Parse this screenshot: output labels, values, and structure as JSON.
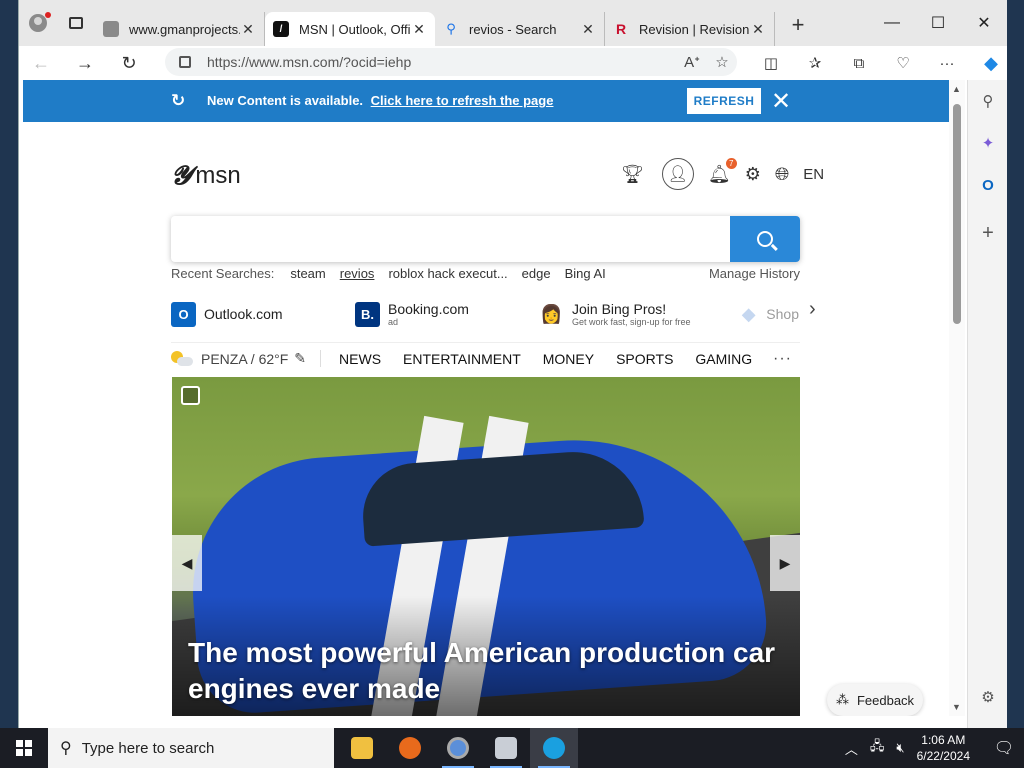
{
  "browser": {
    "tabs": [
      {
        "title": "www.gmanprojects.",
        "favicon_color": "#777777",
        "active": false
      },
      {
        "title": "MSN | Outlook, Offi",
        "favicon_color": "#111111",
        "active": true
      },
      {
        "title": "revios - Search",
        "favicon_color": "#1a73e8",
        "active": false
      },
      {
        "title": "Revision | Revision",
        "favicon_color": "#c8102e",
        "active": false
      }
    ],
    "new_tab": "+",
    "url": "https://www.msn.com/?ocid=iehp",
    "window_controls": {
      "minimize": "—",
      "maximize": "☐",
      "close": "✕"
    }
  },
  "banner": {
    "message": "New Content is available.",
    "link": "Click here to refresh the page",
    "button": "REFRESH",
    "color": "#1f7cc7"
  },
  "msn": {
    "logo_text": "msn",
    "notification_count": "7",
    "language": "EN",
    "recent": {
      "label": "Recent Searches:",
      "items": [
        "steam",
        "revios",
        "roblox hack execut...",
        "edge",
        "Bing AI"
      ],
      "manage": "Manage History"
    },
    "quick_links": [
      {
        "label": "Outlook.com",
        "sub": "",
        "icon": "O",
        "color": "#0a66c2"
      },
      {
        "label": "Booking.com",
        "sub": "ad",
        "icon": "B.",
        "color": "#003580"
      },
      {
        "label": "Join Bing Pros!",
        "sub": "Get work fast, sign-up for free",
        "icon": "👩",
        "color": "#ffffff"
      },
      {
        "label": "Shop",
        "sub": "",
        "icon": "◆",
        "color": "#b9d3f2"
      }
    ],
    "weather": {
      "text": "PENZA / 62°F"
    },
    "nav": [
      "NEWS",
      "ENTERTAINMENT",
      "MONEY",
      "SPORTS",
      "GAMING"
    ],
    "more": "···",
    "hero_headline": "The most powerful American production car engines ever made",
    "feedback": "Feedback"
  },
  "taskbar": {
    "search_placeholder": "Type here to search",
    "time": "1:06 AM",
    "date": "6/22/2024",
    "notification_count": "1"
  }
}
